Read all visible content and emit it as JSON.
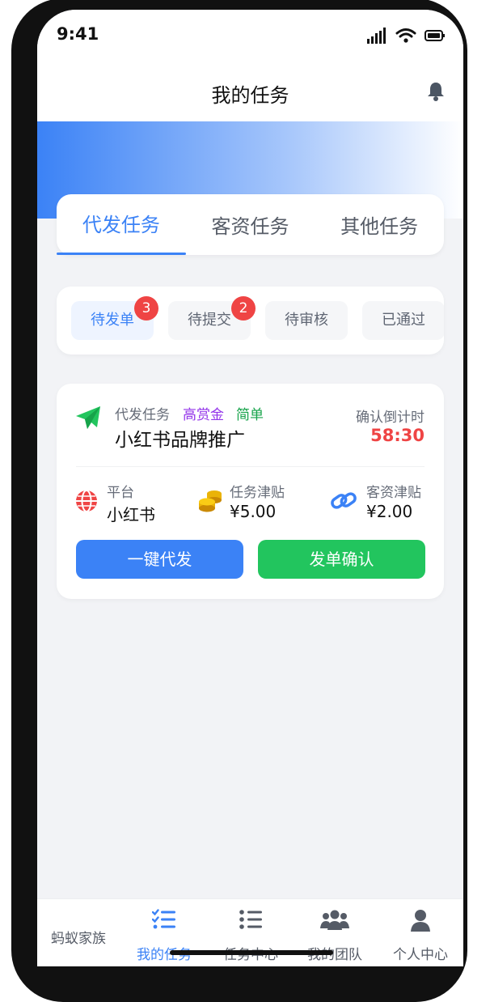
{
  "status_bar": {
    "time": "9:41",
    "icons": [
      "signal-icon",
      "wifi-icon",
      "battery-icon"
    ]
  },
  "header": {
    "title": "我的任务",
    "icon": "bell-icon"
  },
  "main_tabs": [
    {
      "label": "代发任务",
      "active": true
    },
    {
      "label": "客资任务",
      "active": false
    },
    {
      "label": "其他任务",
      "active": false
    }
  ],
  "sub_tabs": [
    {
      "label": "待发单",
      "badge": "3",
      "active": true
    },
    {
      "label": "待提交",
      "badge": "2",
      "active": false
    },
    {
      "label": "待审核",
      "badge": "",
      "active": false
    },
    {
      "label": "已通过",
      "badge": "",
      "active": false
    }
  ],
  "task_card": {
    "icon": "paper-plane-icon",
    "type": "代发任务",
    "tags": {
      "reward": "高赏金",
      "difficulty": "简单"
    },
    "title": "小红书品牌推广",
    "countdown_label": "确认倒计时",
    "countdown": "58:30",
    "info": [
      {
        "icon": "globe-icon",
        "label": "平台",
        "value": "小红书"
      },
      {
        "icon": "coins-icon",
        "label": "任务津贴",
        "value": "¥5.00"
      },
      {
        "icon": "link-icon",
        "label": "客资津贴",
        "value": "¥2.00"
      }
    ],
    "buttons": {
      "primary": "一键代发",
      "secondary": "发单确认"
    }
  },
  "bottom_nav": {
    "brand": "蚂蚁家族",
    "items": [
      {
        "label": "我的任务",
        "icon": "task-list-icon",
        "active": true
      },
      {
        "label": "任务中心",
        "icon": "list-icon",
        "active": false
      },
      {
        "label": "我的团队",
        "icon": "team-icon",
        "active": false
      },
      {
        "label": "个人中心",
        "icon": "user-icon",
        "active": false
      }
    ]
  },
  "colors": {
    "accent": "#3b82f6",
    "success": "#22c55e",
    "danger": "#ef4444",
    "reward_tag": "#9333ea",
    "easy_tag": "#16a34a"
  }
}
